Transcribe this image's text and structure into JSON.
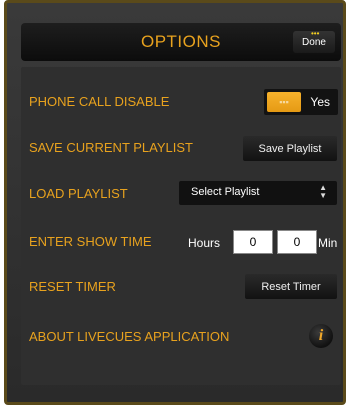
{
  "header": {
    "title": "OPTIONS",
    "done_label": "Done"
  },
  "options": {
    "phone_call_disable": {
      "label": "PHONE CALL DISABLE",
      "toggle_value": "Yes"
    },
    "save_playlist": {
      "label": "SAVE CURRENT PLAYLIST",
      "button_label": "Save Playlist"
    },
    "load_playlist": {
      "label": "LOAD PLAYLIST",
      "select_value": "Select Playlist"
    },
    "show_time": {
      "label": "ENTER SHOW TIME",
      "hours_label": "Hours",
      "hours_value": "0",
      "minutes_value": "0",
      "min_label": "Min"
    },
    "reset_timer": {
      "label": "RESET TIMER",
      "button_label": "Reset Timer"
    },
    "about": {
      "label": "ABOUT LIVECUES APPLICATION",
      "icon": "info-icon"
    }
  },
  "colors": {
    "accent": "#e8a21e",
    "panel": "#2f2f2f",
    "frame_border": "#5a4a1a"
  }
}
